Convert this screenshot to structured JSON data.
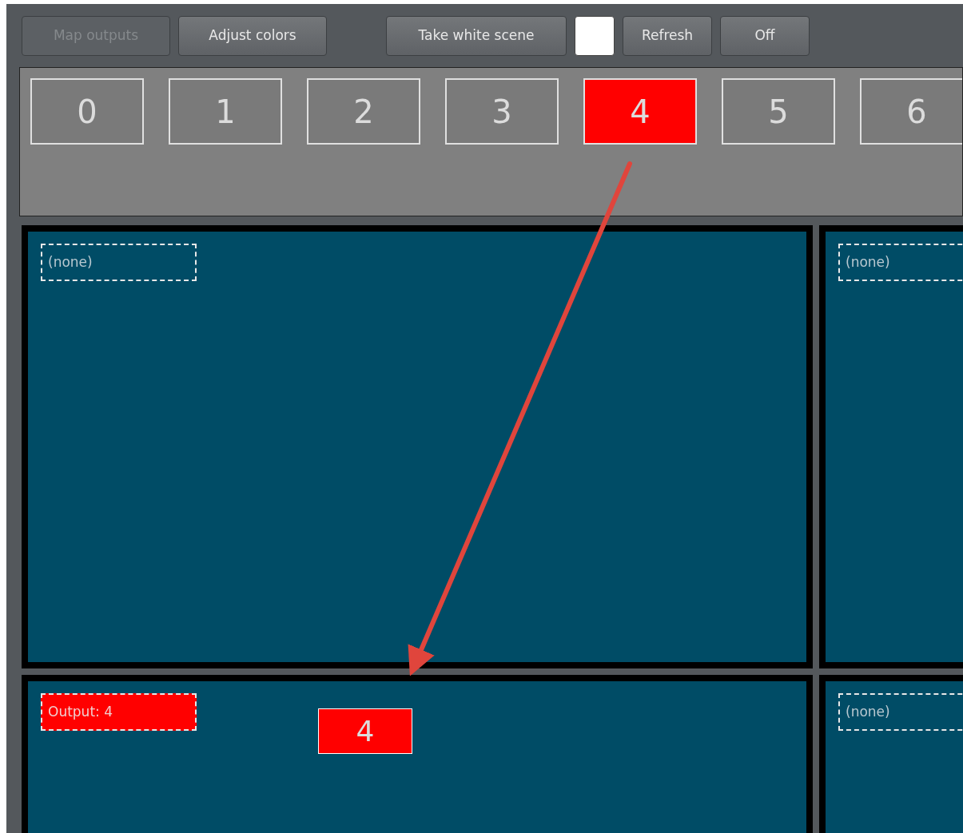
{
  "toolbar": {
    "buttons": [
      {
        "label": "Map outputs",
        "disabled": true,
        "kind": "button"
      },
      {
        "label": "Adjust colors",
        "disabled": false,
        "kind": "button"
      },
      {
        "label": "Take white scene",
        "disabled": false,
        "kind": "button"
      },
      {
        "kind": "swatch"
      },
      {
        "label": "Refresh",
        "disabled": false,
        "kind": "button"
      },
      {
        "label": "Off",
        "disabled": false,
        "kind": "button"
      }
    ]
  },
  "outputs": [
    {
      "label": "0",
      "selected": false
    },
    {
      "label": "1",
      "selected": false
    },
    {
      "label": "2",
      "selected": false
    },
    {
      "label": "3",
      "selected": false
    },
    {
      "label": "4",
      "selected": true
    },
    {
      "label": "5",
      "selected": false
    },
    {
      "label": "6",
      "selected": false
    }
  ],
  "canvas": {
    "cells": [
      {
        "label": "(none)",
        "assigned": false
      },
      {
        "label": "(none)",
        "assigned": false
      },
      {
        "label": "Output: 4",
        "assigned": true
      },
      {
        "label": "(none)",
        "assigned": false
      }
    ]
  },
  "drag_tile": {
    "label": "4"
  }
}
